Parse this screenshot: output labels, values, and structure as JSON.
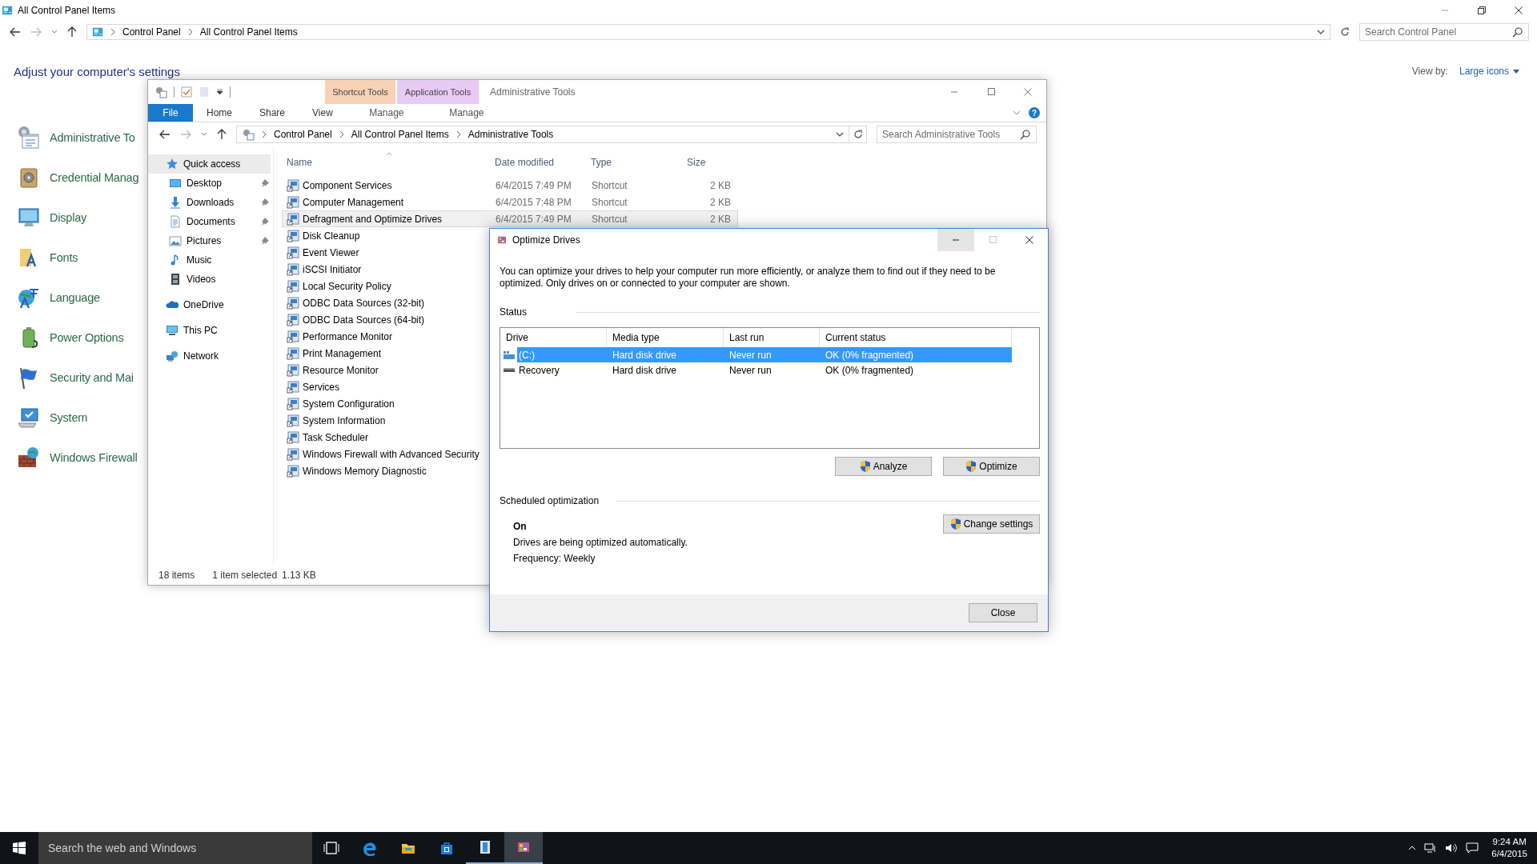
{
  "control_panel": {
    "title": "All Control Panel Items",
    "breadcrumb": [
      "Control Panel",
      "All Control Panel Items"
    ],
    "search": {
      "placeholder": "Search Control Panel"
    },
    "heading": "Adjust your computer's settings",
    "view_by": {
      "label": "View by:",
      "value": "Large icons"
    },
    "items": [
      {
        "label": "Administrative To",
        "kind": "admin"
      },
      {
        "label": "Credential Manag",
        "kind": "credential"
      },
      {
        "label": "Display",
        "kind": "display"
      },
      {
        "label": "Fonts",
        "kind": "fonts"
      },
      {
        "label": "Language",
        "kind": "language"
      },
      {
        "label": "Power Options",
        "kind": "power"
      },
      {
        "label": "Security and Mai",
        "kind": "security"
      },
      {
        "label": "System",
        "kind": "system"
      },
      {
        "label": "Windows Firewall",
        "kind": "firewall"
      }
    ]
  },
  "explorer": {
    "title": "Administrative Tools",
    "context_tabs": [
      {
        "label": "Shortcut Tools",
        "color": "#f9d2b6"
      },
      {
        "label": "Application Tools",
        "color": "#e8caf5"
      }
    ],
    "ribbon_tabs": [
      {
        "label": "File",
        "kind": "file"
      },
      {
        "label": "Home",
        "kind": "tab"
      },
      {
        "label": "Share",
        "kind": "tab"
      },
      {
        "label": "View",
        "kind": "tab"
      },
      {
        "label": "Manage",
        "kind": "context"
      },
      {
        "label": "Manage",
        "kind": "context"
      }
    ],
    "help": "?",
    "breadcrumb": [
      "Control Panel",
      "All Control Panel Items",
      "Administrative Tools"
    ],
    "search": {
      "placeholder": "Search Administrative Tools"
    },
    "nav": [
      {
        "label": "Quick access",
        "kind": "star",
        "selected": true,
        "pinned": false
      },
      {
        "label": "Desktop",
        "kind": "desktop",
        "selected": false,
        "pinned": true
      },
      {
        "label": "Downloads",
        "kind": "download",
        "selected": false,
        "pinned": true
      },
      {
        "label": "Documents",
        "kind": "document",
        "selected": false,
        "pinned": true
      },
      {
        "label": "Pictures",
        "kind": "picture",
        "selected": false,
        "pinned": true
      },
      {
        "label": "Music",
        "kind": "music",
        "selected": false,
        "pinned": false
      },
      {
        "label": "Videos",
        "kind": "video",
        "selected": false,
        "pinned": false
      },
      {
        "label": "OneDrive",
        "kind": "cloud",
        "selected": false,
        "pinned": false
      },
      {
        "label": "This PC",
        "kind": "pc",
        "selected": false,
        "pinned": false
      },
      {
        "label": "Network",
        "kind": "network",
        "selected": false,
        "pinned": false
      }
    ],
    "columns": [
      "Name",
      "Date modified",
      "Type",
      "Size"
    ],
    "files": [
      {
        "name": "Component Services",
        "date": "6/4/2015 7:49 PM",
        "type": "Shortcut",
        "size": "2 KB",
        "selected": false
      },
      {
        "name": "Computer Management",
        "date": "6/4/2015 7:48 PM",
        "type": "Shortcut",
        "size": "2 KB",
        "selected": false
      },
      {
        "name": "Defragment and Optimize Drives",
        "date": "6/4/2015 7:49 PM",
        "type": "Shortcut",
        "size": "2 KB",
        "selected": true
      },
      {
        "name": "Disk Cleanup",
        "selected": false
      },
      {
        "name": "Event Viewer",
        "selected": false
      },
      {
        "name": "iSCSI Initiator",
        "selected": false
      },
      {
        "name": "Local Security Policy",
        "selected": false
      },
      {
        "name": "ODBC Data Sources (32-bit)",
        "selected": false
      },
      {
        "name": "ODBC Data Sources (64-bit)",
        "selected": false
      },
      {
        "name": "Performance Monitor",
        "selected": false
      },
      {
        "name": "Print Management",
        "selected": false
      },
      {
        "name": "Resource Monitor",
        "selected": false
      },
      {
        "name": "Services",
        "selected": false
      },
      {
        "name": "System Configuration",
        "selected": false
      },
      {
        "name": "System Information",
        "selected": false
      },
      {
        "name": "Task Scheduler",
        "selected": false
      },
      {
        "name": "Windows Firewall with Advanced Security",
        "selected": false
      },
      {
        "name": "Windows Memory Diagnostic",
        "selected": false
      }
    ],
    "status": {
      "count": "18 items",
      "selection": "1 item selected",
      "size": "1.13 KB"
    }
  },
  "dialog": {
    "title": "Optimize Drives",
    "controls": [
      {
        "kind": "minimize",
        "hovered": true,
        "disabled": false
      },
      {
        "kind": "maximize",
        "hovered": false,
        "disabled": true
      },
      {
        "kind": "close",
        "hovered": false,
        "disabled": false
      }
    ],
    "description": "You can optimize your drives to help your computer run more efficiently, or analyze them to find out if they need to be optimized. Only drives on or connected to your computer are shown.",
    "status_label": "Status",
    "columns": [
      "Drive",
      "Media type",
      "Last run",
      "Current status"
    ],
    "drives": [
      {
        "name": "(C:)",
        "kind": "system",
        "media": "Hard disk drive",
        "last_run": "Never run",
        "status": "OK (0% fragmented)",
        "selected": true
      },
      {
        "name": "Recovery",
        "kind": "disk",
        "media": "Hard disk drive",
        "last_run": "Never run",
        "status": "OK (0% fragmented)",
        "selected": false
      }
    ],
    "buttons": [
      "Analyze",
      "Optimize"
    ],
    "schedule": {
      "label": "Scheduled optimization",
      "state": "On",
      "note": "Drives are being optimized automatically.",
      "frequency": "Frequency: Weekly",
      "button": "Change settings"
    },
    "close": "Close"
  },
  "taskbar": {
    "search": {
      "placeholder": "Search the web and Windows"
    },
    "apps": [
      {
        "kind": "taskview",
        "running": false,
        "active": false
      },
      {
        "kind": "edge",
        "running": false,
        "active": false
      },
      {
        "kind": "explorer",
        "running": false,
        "active": false
      },
      {
        "kind": "store",
        "running": false,
        "active": false
      },
      {
        "kind": "doc",
        "running": true,
        "active": false
      },
      {
        "kind": "defrag",
        "running": true,
        "active": true
      }
    ],
    "time": "9:24 AM",
    "date": "6/4/2015"
  }
}
